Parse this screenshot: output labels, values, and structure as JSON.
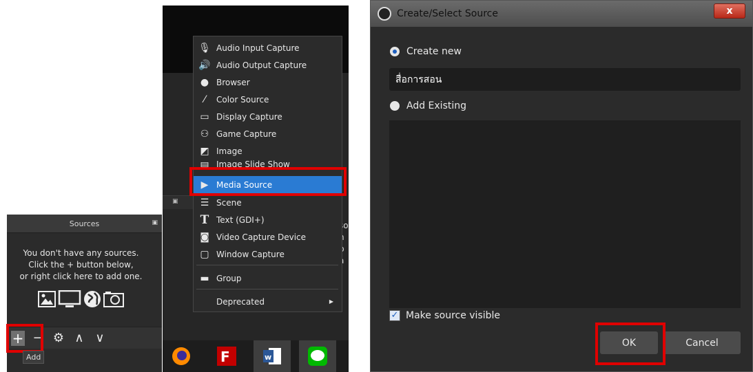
{
  "sources_panel": {
    "title": "Sources",
    "empty_message": [
      "You don't have any sources.",
      "Click the + button below,",
      "or right click here to add one."
    ],
    "toolbar": {
      "add_label": "+",
      "remove_label": "−",
      "settings_label": "⚙",
      "up_label": "∧",
      "down_label": "∨"
    },
    "tooltip": "Add"
  },
  "context_menu": {
    "items": [
      {
        "label": "Audio Input Capture",
        "icon": "microphone-icon"
      },
      {
        "label": "Audio Output Capture",
        "icon": "speaker-icon"
      },
      {
        "label": "Browser",
        "icon": "globe-icon"
      },
      {
        "label": "Color Source",
        "icon": "brush-icon"
      },
      {
        "label": "Display Capture",
        "icon": "monitor-icon"
      },
      {
        "label": "Game Capture",
        "icon": "gamepad-icon"
      },
      {
        "label": "Image",
        "icon": "image-icon"
      },
      {
        "label": "Image Slide Show",
        "icon": "slideshow-icon"
      },
      {
        "label": "Media Source",
        "icon": "play-icon"
      },
      {
        "label": "Scene",
        "icon": "list-icon"
      },
      {
        "label": "Text (GDI+)",
        "icon": "text-icon"
      },
      {
        "label": "Video Capture Device",
        "icon": "camera-icon"
      },
      {
        "label": "Window Capture",
        "icon": "window-icon"
      },
      {
        "label": "Group",
        "icon": "folder-icon"
      },
      {
        "label": "Deprecated",
        "icon": ""
      }
    ],
    "selected": "Media Source",
    "accent": "#2a7bd3"
  },
  "behind_text": [
    "so",
    "n b",
    "a"
  ],
  "taskbar": [
    "firefox-icon",
    "filezilla-icon",
    "word-icon",
    "line-icon"
  ],
  "dialog": {
    "title": "Create/Select Source",
    "close_label": "x",
    "create_new_label": "Create new",
    "name_value": "สื่อการสอน",
    "add_existing_label": "Add Existing",
    "make_visible_label": "Make source visible",
    "ok_label": "OK",
    "cancel_label": "Cancel"
  },
  "highlight_color": "#e00000"
}
